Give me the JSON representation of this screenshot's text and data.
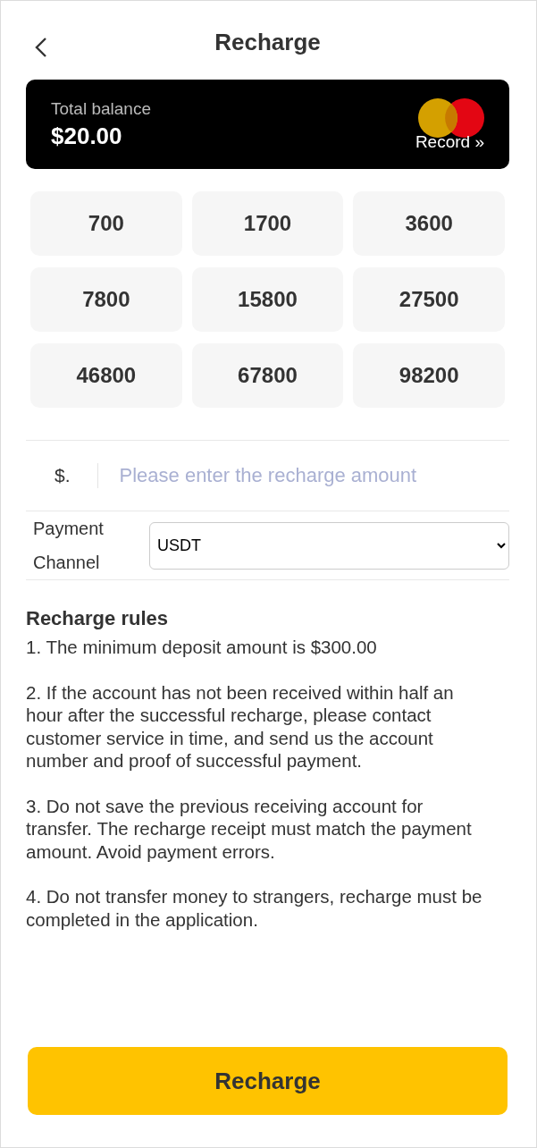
{
  "header": {
    "title": "Recharge"
  },
  "balance_card": {
    "label": "Total balance",
    "amount": "$20.00",
    "record_link": "Record »"
  },
  "amounts": [
    {
      "label": "700",
      "selected": false
    },
    {
      "label": "1700",
      "selected": false
    },
    {
      "label": "3600",
      "selected": false
    },
    {
      "label": "7800",
      "selected": false
    },
    {
      "label": "15800",
      "selected": false
    },
    {
      "label": "27500",
      "selected": false
    },
    {
      "label": "46800",
      "selected": false
    },
    {
      "label": "67800",
      "selected": false
    },
    {
      "label": "98200",
      "selected": false
    }
  ],
  "amount_field": {
    "prefix": "$.",
    "placeholder": "Please enter the recharge amount"
  },
  "payment_channel": {
    "label": "Payment Channel",
    "value": "USDT"
  },
  "rules": {
    "title": "Recharge rules",
    "items": [
      "1. The minimum deposit amount is $300.00",
      "2. If the account has not been received within half an hour after the successful recharge, please contact customer service in time, and send us the account number and proof of successful payment.",
      "3. Do not save the previous receiving account for transfer. The recharge receipt must match the payment amount. Avoid payment errors.",
      "4. Do not transfer money to strangers, recharge must be completed in the application."
    ]
  },
  "submit_button": "Recharge"
}
